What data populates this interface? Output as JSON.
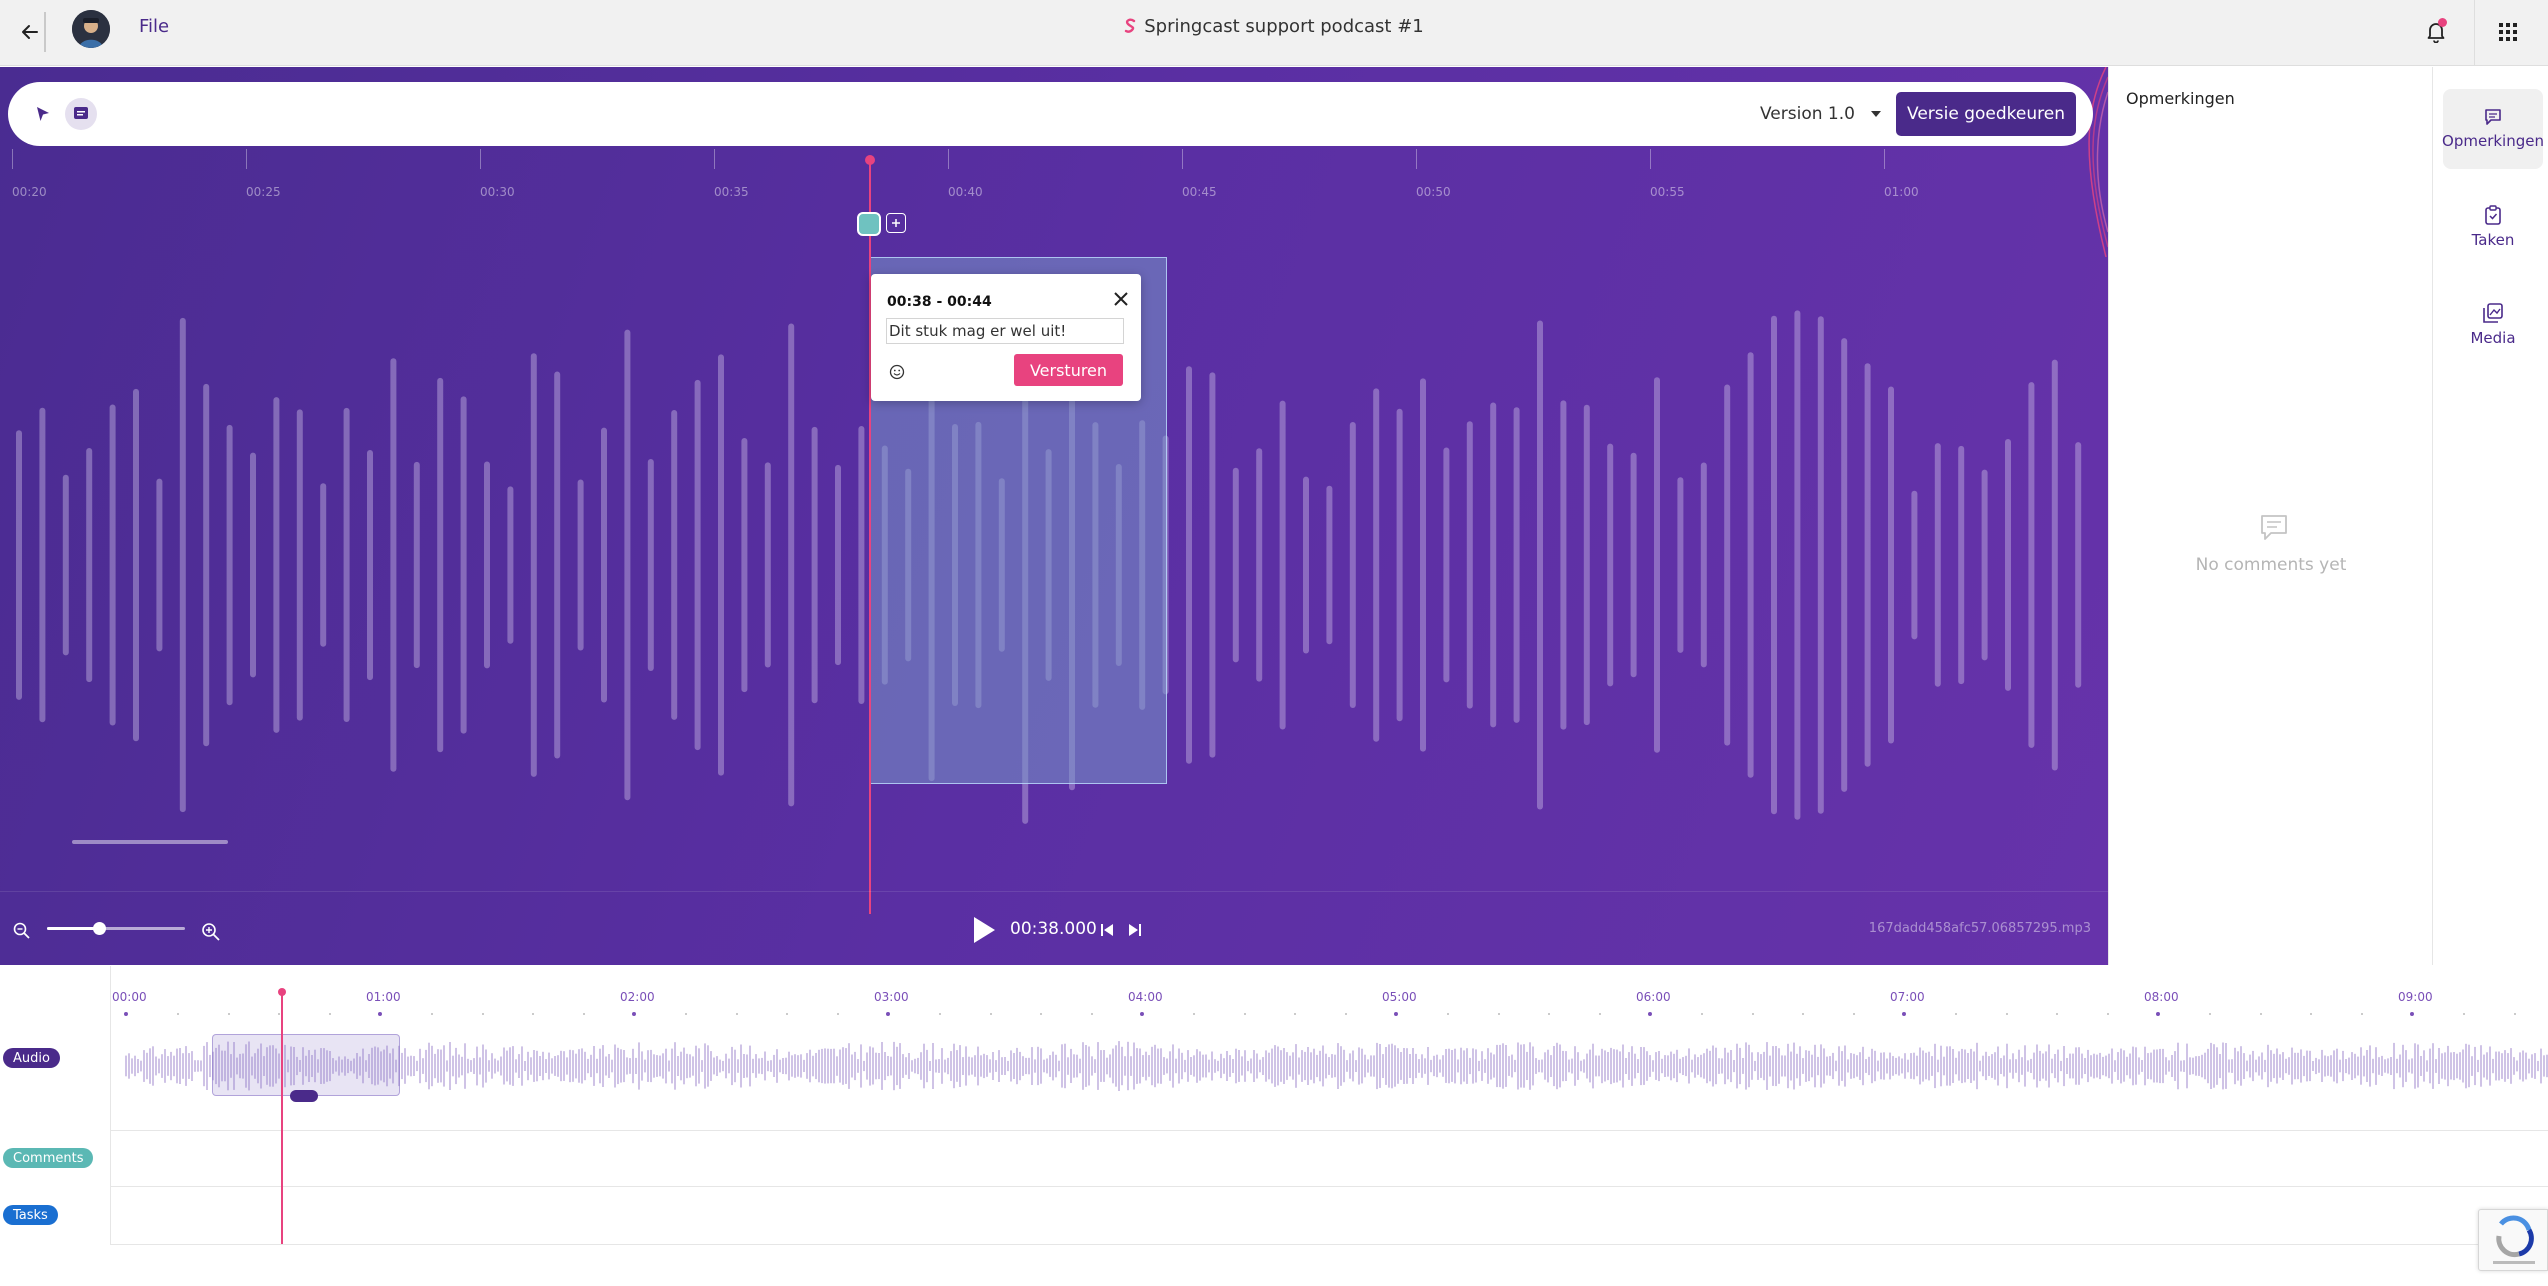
{
  "topbar": {
    "file_label": "File",
    "title": "Springcast support podcast #1",
    "icons": {
      "back": "arrow-left-icon",
      "notifications": "bell-icon",
      "apps": "grid-icon"
    },
    "notification_dot_color": "#e8437f"
  },
  "toolbar": {
    "version_label": "Version 1.0",
    "approve_label": "Versie goedkeuren",
    "tools": [
      "pointer-icon",
      "comment-tool-icon"
    ]
  },
  "ruler": {
    "labels": [
      "00:20",
      "00:25",
      "00:30",
      "00:35",
      "00:40",
      "00:45",
      "00:50",
      "00:55",
      "01:00"
    ]
  },
  "popup": {
    "time_range": "00:38 - 00:44",
    "input_value": "Dit stuk mag er wel uit!",
    "send_label": "Versturen"
  },
  "controls": {
    "time": "00:38.000",
    "file_name": "167dadd458afc57.06857295.mp3",
    "zoom_level": 0.38
  },
  "comments_panel": {
    "title": "Opmerkingen",
    "empty_text": "No comments yet"
  },
  "side_nav": {
    "items": [
      {
        "label": "Opmerkingen",
        "icon": "comment-icon"
      },
      {
        "label": "Taken",
        "icon": "clipboard-icon"
      },
      {
        "label": "Media",
        "icon": "media-icon"
      }
    ]
  },
  "timeline": {
    "labels": [
      "00:00",
      "01:00",
      "02:00",
      "03:00",
      "04:00",
      "05:00",
      "06:00",
      "07:00",
      "08:00",
      "09:00"
    ],
    "tracks": [
      {
        "label": "Audio",
        "color": "#4a2a8a"
      },
      {
        "label": "Comments",
        "color": "#5bb8b4"
      },
      {
        "label": "Tasks",
        "color": "#1a6fd1"
      }
    ]
  },
  "colors": {
    "accent_purple": "#4a2a8a",
    "accent_pink": "#e8437f",
    "marker_teal": "#6fc2c0"
  }
}
